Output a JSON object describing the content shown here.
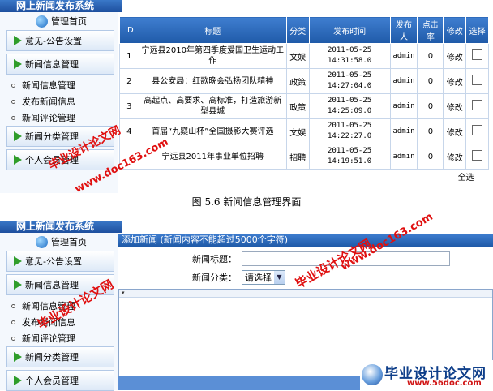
{
  "app_title": "网上新闻发布系统",
  "sidebar": {
    "home_label": "管理首页",
    "groups": [
      {
        "label": "意见-公告设置"
      },
      {
        "label": "新闻信息管理"
      }
    ],
    "subitems": [
      "新闻信息管理",
      "发布新闻信息",
      "新闻评论管理"
    ],
    "groups_after": [
      {
        "label": "新闻分类管理"
      },
      {
        "label": "个人会员管理"
      }
    ]
  },
  "news_table": {
    "headers": [
      "ID",
      "标题",
      "分类",
      "发布时间",
      "发布人",
      "点击率",
      "修改",
      "选择"
    ],
    "rows": [
      {
        "id": "1",
        "title": "宁远县2010年第四季度爱国卫生运动工作",
        "category": "文娱",
        "date": "2011-05-25",
        "time": "14:31:58.0",
        "author": "admin",
        "clicks": "0",
        "edit": "修改"
      },
      {
        "id": "2",
        "title": "县公安局：红歌晚会弘扬团队精神",
        "category": "政策",
        "date": "2011-05-25",
        "time": "14:27:04.0",
        "author": "admin",
        "clicks": "0",
        "edit": "修改"
      },
      {
        "id": "3",
        "title": "高起点、高要求、高标准，打造旅游新型县城",
        "category": "政策",
        "date": "2011-05-25",
        "time": "14:25:09.0",
        "author": "admin",
        "clicks": "0",
        "edit": "修改"
      },
      {
        "id": "4",
        "title": "首届“九嶷山杯”全国摄影大赛评选",
        "category": "文娱",
        "date": "2011-05-25",
        "time": "14:22:27.0",
        "author": "admin",
        "clicks": "0",
        "edit": "修改"
      },
      {
        "id": "",
        "title": "宁远县2011年事业单位招聘",
        "category": "招聘",
        "date": "2011-05-25",
        "time": "14:19:51.0",
        "author": "admin",
        "clicks": "0",
        "edit": "修改"
      }
    ],
    "select_all": "全选"
  },
  "caption": "图 5.6   新闻信息管理界面",
  "form": {
    "header": "添加新闻 (新闻内容不能超过5000个字符)",
    "title_label": "新闻标题：",
    "title_value": "",
    "category_label": "新闻分类：",
    "category_value": "请选择"
  },
  "watermarks": {
    "site": "毕业设计论文网",
    "url": "www.doc163.com"
  },
  "brand": {
    "name": "毕业设计论文网",
    "url": "www.56doc.com"
  },
  "colors": {
    "header_blue": "#2a66b8",
    "accent_green": "#2f9d2a",
    "watermark_red": "#e01010"
  }
}
